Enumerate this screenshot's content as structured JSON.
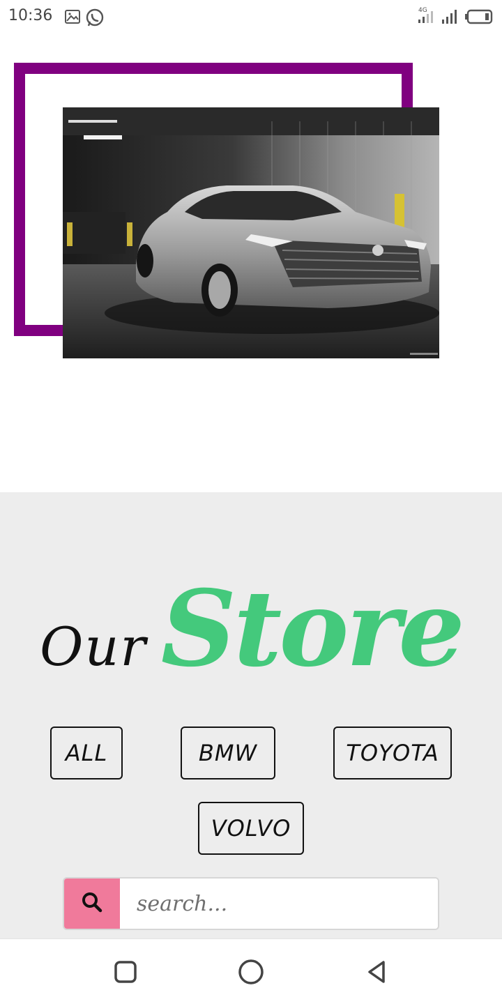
{
  "status_bar": {
    "time": "10:36",
    "network": "4G",
    "icons": [
      "gallery-icon",
      "whatsapp-icon",
      "signal-4g-icon",
      "signal-icon",
      "battery-icon"
    ]
  },
  "hero": {
    "image_subject": "silver Toyota sedan in parking garage",
    "frame_color": "#800080"
  },
  "store": {
    "title_prefix": "Our",
    "title_main": "Store",
    "accent_color": "#44c97c",
    "filters": [
      "ALL",
      "BMW",
      "TOYOTA",
      "VOLVO"
    ],
    "search": {
      "placeholder": "search...",
      "button_color": "#f07a9b"
    }
  },
  "nav_bar": {
    "buttons": [
      "recent-apps-icon",
      "home-icon",
      "back-icon"
    ]
  }
}
